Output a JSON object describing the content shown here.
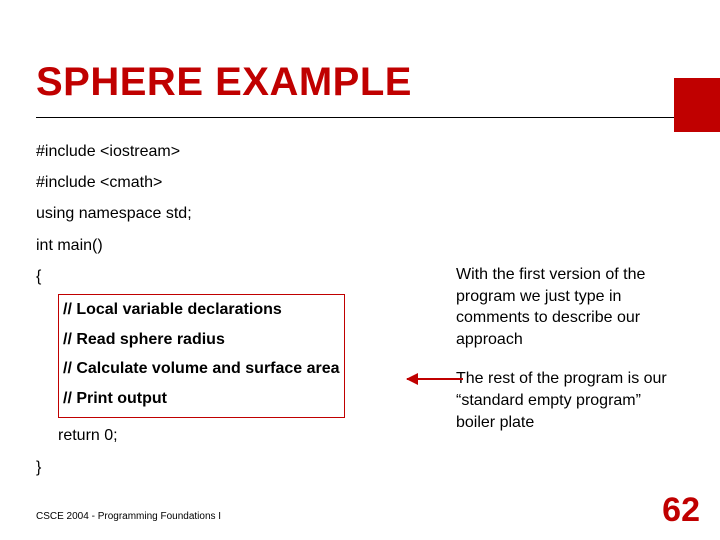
{
  "title": "SPHERE EXAMPLE",
  "code": {
    "l1": "#include <iostream>",
    "l2": "#include <cmath>",
    "l3": "using namespace std;",
    "l4": "int main()",
    "l5": "{",
    "c1": "// Local variable declarations",
    "c2": "// Read sphere radius",
    "c3": "// Calculate volume and surface area",
    "c4": "// Print output",
    "l6": "return 0;",
    "l7": "}"
  },
  "notes": {
    "p1": "With the first version of the program we just type in comments to describe our approach",
    "p2": "The rest of the program is our “standard empty program” boiler plate"
  },
  "footer": "CSCE 2004 - Programming Foundations I",
  "page": "62"
}
